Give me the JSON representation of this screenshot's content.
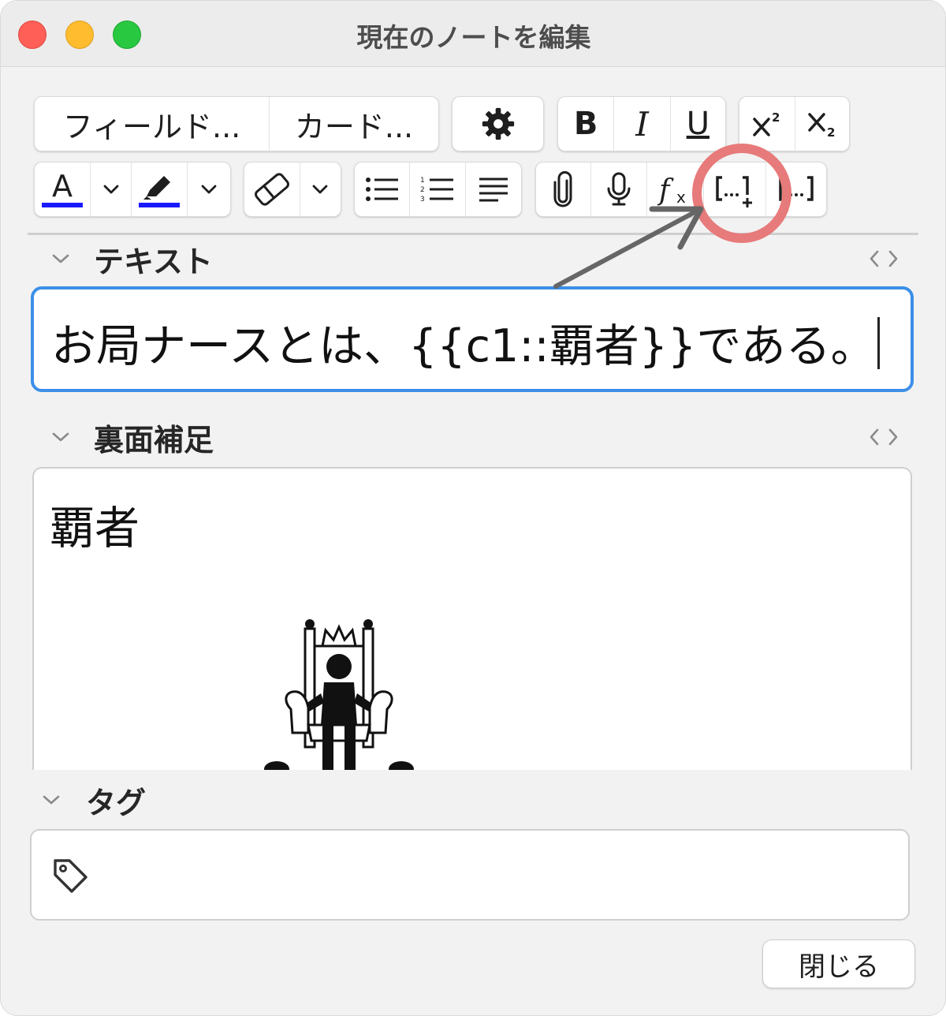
{
  "window": {
    "title": "現在のノートを編集"
  },
  "toolbar": {
    "fields_label": "フィールド...",
    "cards_label": "カード...",
    "bold_label": "B",
    "italic_label": "I",
    "underline_label": "U",
    "text_color": "#1a1aff",
    "highlight_color": "#1a1aff"
  },
  "fields": [
    {
      "label": "テキスト",
      "value": "お局ナースとは、{{c1::覇者}}である。"
    },
    {
      "label": "裏面補足",
      "value": "覇者"
    }
  ],
  "tags": {
    "label": "タグ",
    "value": ""
  },
  "footer": {
    "close_label": "閉じる"
  },
  "colors": {
    "focus_border": "#3b8fe8",
    "annotation_circle": "#e77a7a",
    "annotation_arrow": "#666666"
  }
}
